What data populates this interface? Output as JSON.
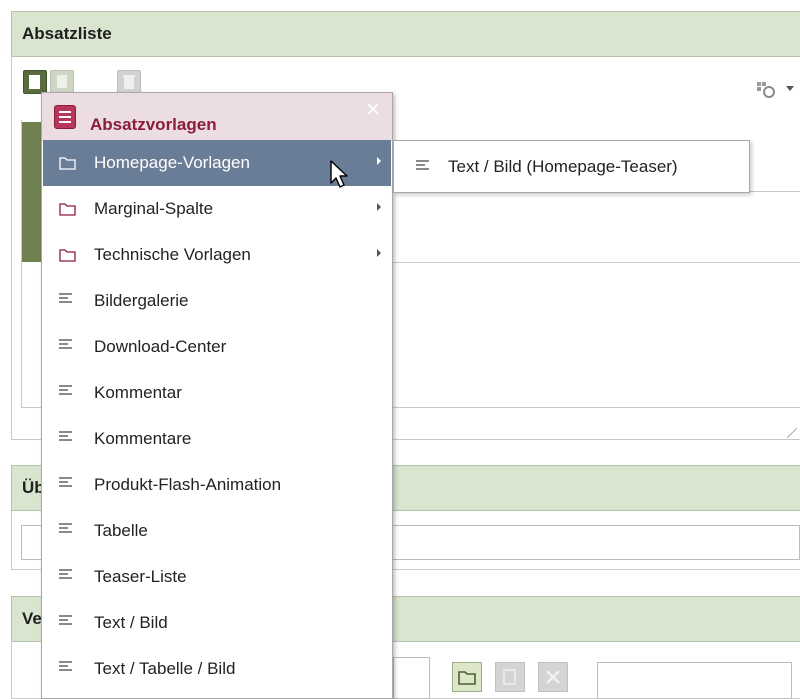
{
  "panels": {
    "absatzliste_title": "Absatzliste",
    "section2_partial": "Üb",
    "section3_partial": "Ve"
  },
  "menu": {
    "title": "Absatzvorlagen",
    "close_symbol": "×",
    "items": [
      {
        "label": "Homepage-Vorlagen",
        "type": "folder",
        "submenu": true,
        "active": true
      },
      {
        "label": "Marginal-Spalte",
        "type": "folder",
        "submenu": true
      },
      {
        "label": "Technische Vorlagen",
        "type": "folder",
        "submenu": true
      },
      {
        "label": "Bildergalerie",
        "type": "template"
      },
      {
        "label": "Download-Center",
        "type": "template"
      },
      {
        "label": "Kommentar",
        "type": "template"
      },
      {
        "label": "Kommentare",
        "type": "template"
      },
      {
        "label": "Produkt-Flash-Animation",
        "type": "template"
      },
      {
        "label": "Tabelle",
        "type": "template"
      },
      {
        "label": "Teaser-Liste",
        "type": "template"
      },
      {
        "label": "Text / Bild",
        "type": "template"
      },
      {
        "label": "Text / Tabelle / Bild",
        "type": "template"
      }
    ]
  },
  "submenu": {
    "items": [
      {
        "label": "Text / Bild (Homepage-Teaser)",
        "type": "template"
      }
    ]
  },
  "colors": {
    "panel_header_bg": "#d9e5cf",
    "menu_header_bg": "#ecdde2",
    "menu_title_color": "#8a1c3c",
    "active_item_bg": "#6a7d96",
    "green_block": "#6f8150"
  }
}
